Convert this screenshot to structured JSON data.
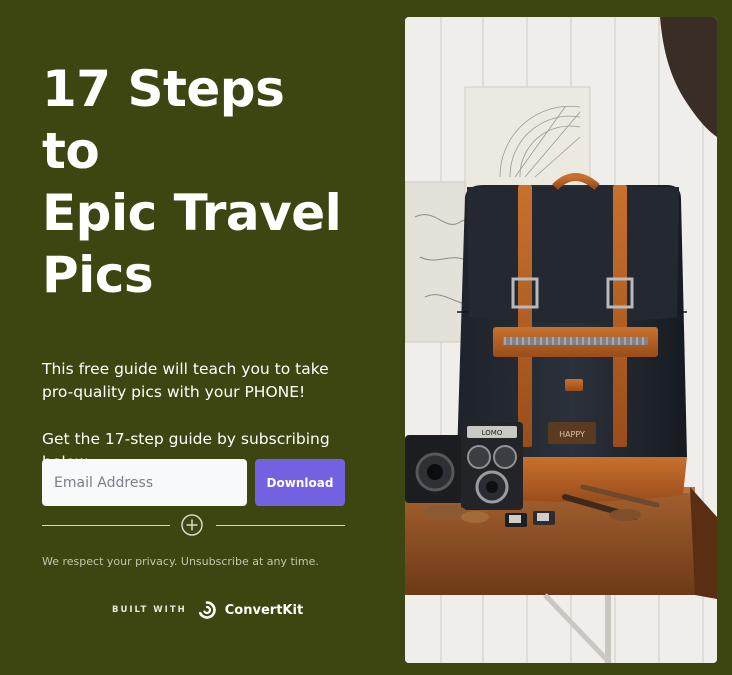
{
  "headline": {
    "line1": "17 Steps to",
    "line2": "Epic Travel",
    "line3": "Pics"
  },
  "description": {
    "p1": "This free guide will teach you to take pro-quality pics with your PHONE!",
    "p2": "Get the 17-step guide by subscribing below."
  },
  "form": {
    "email_placeholder": "Email Address",
    "button_label": "Download"
  },
  "privacy_text": "We respect your privacy. Unsubscribe at any time.",
  "footer": {
    "built_with": "BUILT WITH",
    "brand": "ConvertKit"
  },
  "photo": {
    "patch_text": "HAPPY",
    "lens_text": "LOMO"
  },
  "colors": {
    "background": "#3d4510",
    "button": "#7261e0",
    "input_bg": "#f8f9fa"
  }
}
